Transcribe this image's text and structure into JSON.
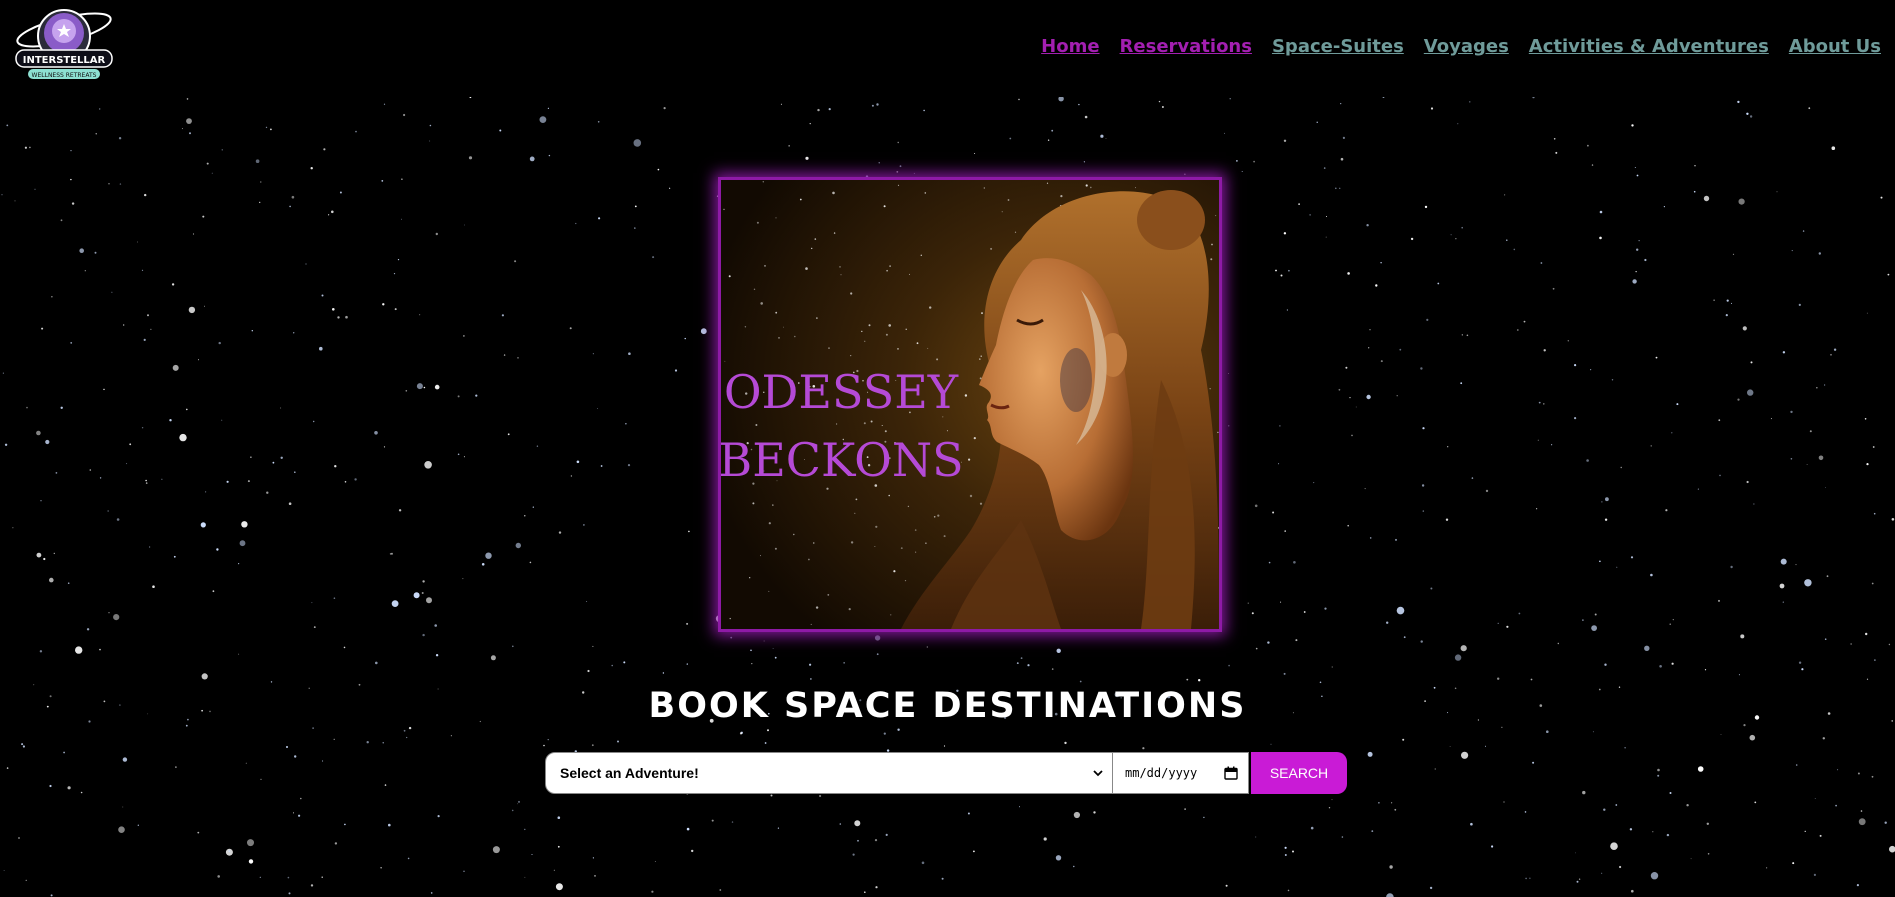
{
  "brand": {
    "logo_text": "INTERSTELLAR",
    "logo_subtext": "WELLNESS RETREATS",
    "logo_icon": "astronaut-helmet-star-icon"
  },
  "nav": {
    "items": [
      {
        "label": "Home",
        "visited": true
      },
      {
        "label": "Reservations",
        "visited": true
      },
      {
        "label": "Space-Suites",
        "visited": false
      },
      {
        "label": "Voyages",
        "visited": false
      },
      {
        "label": "Activities & Adventures",
        "visited": false
      },
      {
        "label": "About Us",
        "visited": false
      }
    ]
  },
  "hero": {
    "line1": "ODESSEY",
    "line2": "BECKONS"
  },
  "booking": {
    "title": "BOOK SPACE DESTINATIONS",
    "select_value": "Select an Adventure!",
    "date_placeholder": "mm/dd/yyyy",
    "search_label": "SEARCH"
  },
  "colors": {
    "accent_purple": "#c91bd6",
    "visited_link": "#a31fb1",
    "link": "#6f9b9a",
    "hero_text": "#b54ad6",
    "background": "#000000"
  }
}
